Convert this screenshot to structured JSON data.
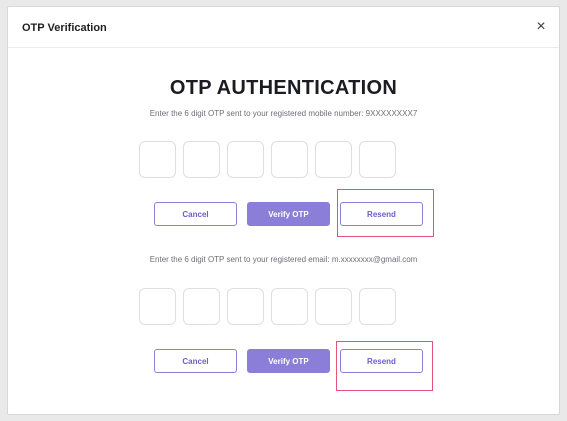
{
  "dialog": {
    "title": "OTP Verification",
    "close_label": "×"
  },
  "main_title": "OTP AUTHENTICATION",
  "mobile_section": {
    "instruction": "Enter the 6 digit OTP sent to your registered mobile number: 9XXXXXXXX7",
    "otp_digits": [
      "",
      "",
      "",
      "",
      "",
      ""
    ],
    "cancel_label": "Cancel",
    "verify_label": "Verify OTP",
    "resend_label": "Resend"
  },
  "email_section": {
    "instruction": "Enter the 6 digit OTP sent to your registered email: m.xxxxxxxx@gmail.com",
    "otp_digits": [
      "",
      "",
      "",
      "",
      "",
      ""
    ],
    "cancel_label": "Cancel",
    "verify_label": "Verify OTP",
    "resend_label": "Resend"
  },
  "colors": {
    "accent": "#8a7ed8",
    "highlight": "#e4537a"
  }
}
